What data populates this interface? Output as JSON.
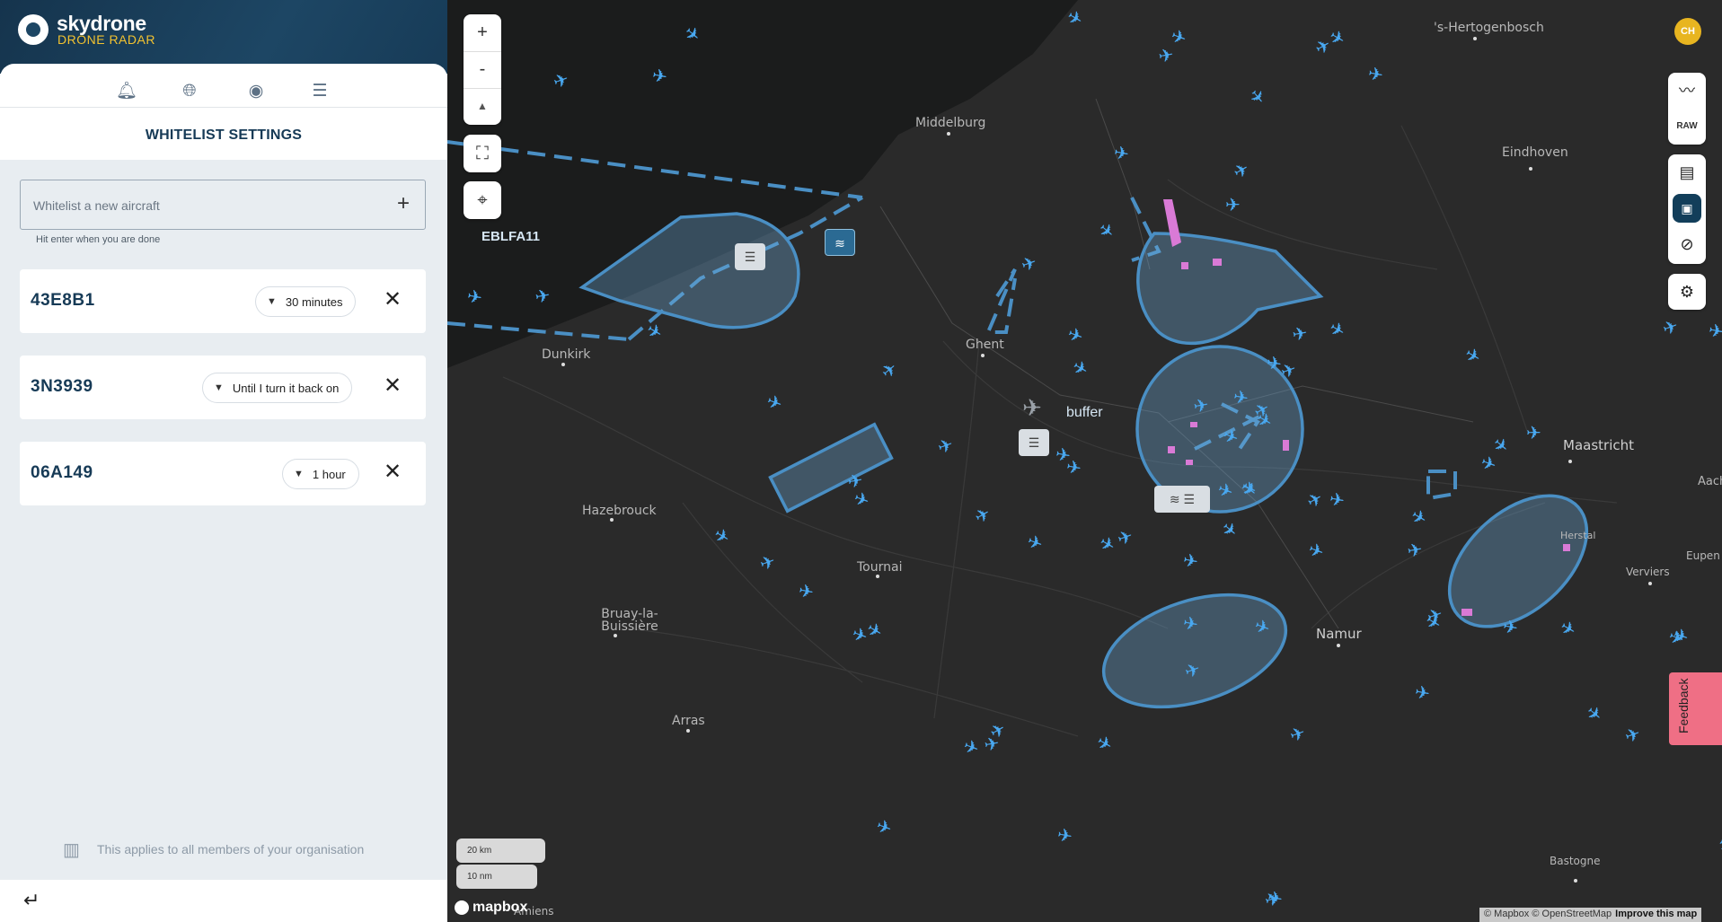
{
  "brand": {
    "name": "skydrone",
    "subtitle": "DRONE RADAR"
  },
  "panel": {
    "nav_icons": [
      "bell-icon",
      "globe-icon",
      "radar-icon",
      "menu-icon"
    ],
    "title": "WHITELIST SETTINGS"
  },
  "whitelist_input": {
    "placeholder": "Whitelist a new aircraft",
    "hint": "Hit enter when you are done",
    "add_icon": "plus-icon"
  },
  "aircraft": [
    {
      "code": "43E8B1",
      "duration": "30 minutes"
    },
    {
      "code": "3N3939",
      "duration": "Until I turn it back on"
    },
    {
      "code": "06A149",
      "duration": "1 hour"
    }
  ],
  "org_note": "This applies to all members of your organisation",
  "map": {
    "zoom_in": "+",
    "zoom_out": "-",
    "compass": "▲",
    "zone_label": "EBLFA11",
    "buffer_label": "buffer",
    "cities": [
      {
        "name": "Middelburg"
      },
      {
        "name": "Dunkirk"
      },
      {
        "name": "Ghent"
      },
      {
        "name": "Hazebrouck"
      },
      {
        "name": "Tournai"
      },
      {
        "name": "Bruay-la-Buissière"
      },
      {
        "name": "Arras"
      },
      {
        "name": "Namur"
      },
      {
        "name": "Maastricht"
      },
      {
        "name": "Eindhoven"
      },
      {
        "name": "'s-Hertogenbosch"
      },
      {
        "name": "Verviers"
      },
      {
        "name": "Bastogne"
      },
      {
        "name": "Herstal"
      },
      {
        "name": "Eupen"
      },
      {
        "name": "Amiens"
      },
      {
        "name": "Aach"
      }
    ],
    "scale_km": "20 km",
    "scale_nm": "10 nm",
    "mapbox": "mapbox",
    "attribution": "© Mapbox © OpenStreetMap",
    "improve": "Improve this map"
  },
  "right_controls": {
    "avatar": "CH",
    "raw_label": "RAW",
    "feedback": "Feedback"
  },
  "colors": {
    "brand_dark": "#15344d",
    "brand_yellow": "#f2c230",
    "zone_stroke": "#4a8fc4",
    "aircraft": "#49a8f0",
    "restricted": "#d97ad6"
  }
}
